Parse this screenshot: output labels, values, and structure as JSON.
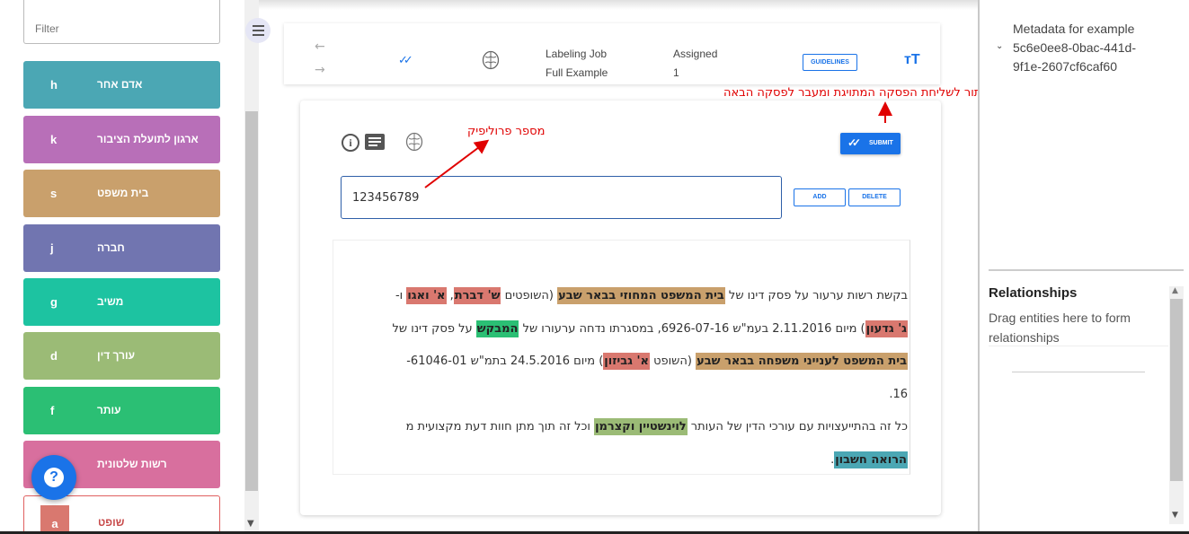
{
  "filter": {
    "placeholder": "Filter"
  },
  "labels": [
    {
      "key": "h",
      "name": "אדם אחר",
      "color": "#4ba7b4"
    },
    {
      "key": "k",
      "name": "ארגון לתועלת הציבור",
      "color": "#b86fb8"
    },
    {
      "key": "s",
      "name": "בית משפט",
      "color": "#c9a06c"
    },
    {
      "key": "j",
      "name": "חברה",
      "color": "#7175b0"
    },
    {
      "key": "g",
      "name": "משיב",
      "color": "#1dc3a1"
    },
    {
      "key": "d",
      "name": "עורך דין",
      "color": "#9bbb76"
    },
    {
      "key": "f",
      "name": "עותר",
      "color": "#2bbf74"
    },
    {
      "key": "",
      "name": "רשות שלטונית",
      "color": "#d86f9e"
    },
    {
      "key": "a",
      "name": "שופט",
      "color": "#d9786f"
    }
  ],
  "help": {
    "label": "?"
  },
  "toolbar": {
    "job_label": "Labeling Job",
    "job_name": "Full Example",
    "assigned_label": "Assigned",
    "assigned_count": "1",
    "guidelines": "GUIDELINES",
    "font_toggle": "тT"
  },
  "card": {
    "submit": "SUBMIT",
    "id_value": "123456789",
    "add": "ADD",
    "delete": "DELETE"
  },
  "text": {
    "l1": {
      "a": "בקשת רשות ערעור על פסק דינו של ",
      "e1": "בית המשפט המחוזי בבאר שבע",
      "b": " (השופטים ",
      "e2": "ש' דברת",
      "c": ", ",
      "e3": "א' ואגו",
      "d": " ו-"
    },
    "l2": {
      "e1": "ג' גדעון",
      "a": ") מיום 2.11.2016 בעמ\"ש 6926-07-16, במסגרתו נדחה ערעורו של ",
      "e2": "המבקש",
      "b": " על פסק דינו של"
    },
    "l3": {
      "e1": "בית המשפט לענייני משפחה בבאר שבע",
      "a": " (השופט ",
      "e2": "א' גביזון",
      "b": ") מיום 24.5.2016 בתמ\"ש 61046-01-"
    },
    "l4": {
      "a": "16."
    },
    "l5": {
      "a": "כל זה בהתייעצויות עם עורכי הדין של העותר ",
      "e1": "לוינשטיין וקצרמן",
      "b": " וכל זה תוך מתן חוות דעת מקצועית מ"
    },
    "l6": {
      "e1": "הרואה חשבון",
      "a": "."
    }
  },
  "annotations": {
    "submit_note": "כפתור לשליחת הפסקה המתויגת ומעבר לפסקה הבאה",
    "id_note": "מספר פרוליפיק"
  },
  "metadata": {
    "title": "Metadata for example",
    "id_line1": "5c6e0ee8-0bac-441d-",
    "id_line2": "9f1e-2607cf6caf60"
  },
  "relationships": {
    "title": "Relationships",
    "desc": "Drag entities here to form relationships"
  }
}
